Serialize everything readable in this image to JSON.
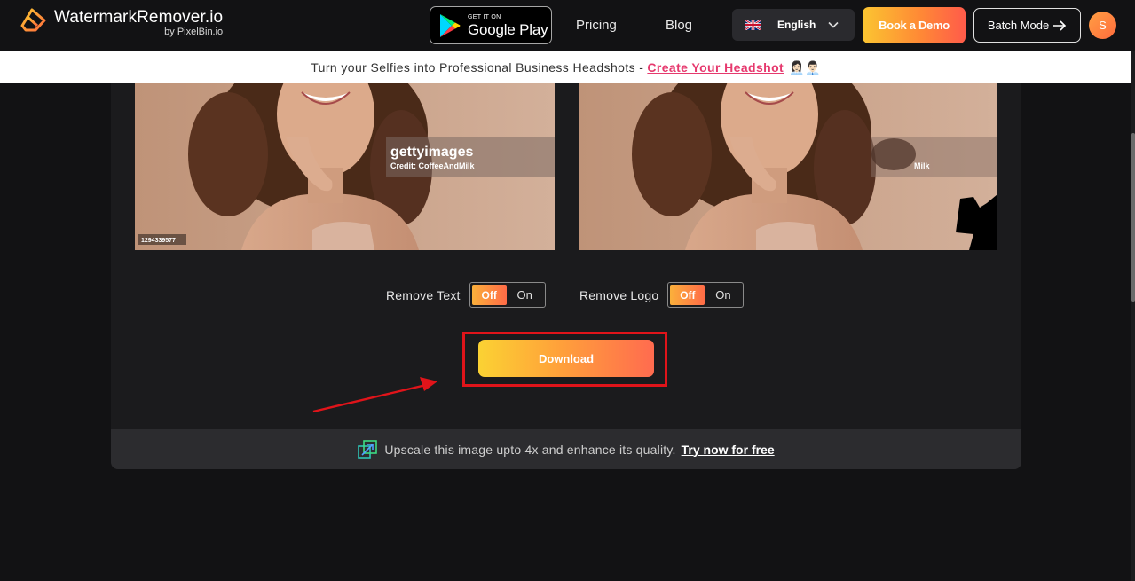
{
  "header": {
    "logo_title": "WatermarkRemover.io",
    "logo_sub": "by PixelBin.io",
    "gplay_small": "GET IT ON",
    "gplay_big": "Google Play",
    "nav_pricing": "Pricing",
    "nav_blog": "Blog",
    "language": "English",
    "book_demo": "Book a Demo",
    "batch_mode": "Batch Mode",
    "avatar_initial": "S"
  },
  "banner": {
    "text": "Turn your Selfies into Professional Business Headshots -",
    "link": "Create Your Headshot",
    "emoji": "👩🏻‍💼👨🏻‍💼"
  },
  "images": {
    "left_watermark_brand": "gettyimages",
    "left_watermark_credit": "Credit: CoffeeAndMilk",
    "left_id": "1294339577",
    "right_residual": "Milk"
  },
  "controls": {
    "remove_text_label": "Remove Text",
    "remove_logo_label": "Remove Logo",
    "off_label": "Off",
    "on_label": "On",
    "download": "Download"
  },
  "upscale": {
    "text": "Upscale this image upto 4x and enhance its quality.",
    "link": "Try now for free"
  },
  "colors": {
    "accent_gradient_start": "#fbd233",
    "accent_gradient_end": "#ff6b4f",
    "highlight_red": "#e0141a",
    "banner_link": "#e6396e"
  }
}
